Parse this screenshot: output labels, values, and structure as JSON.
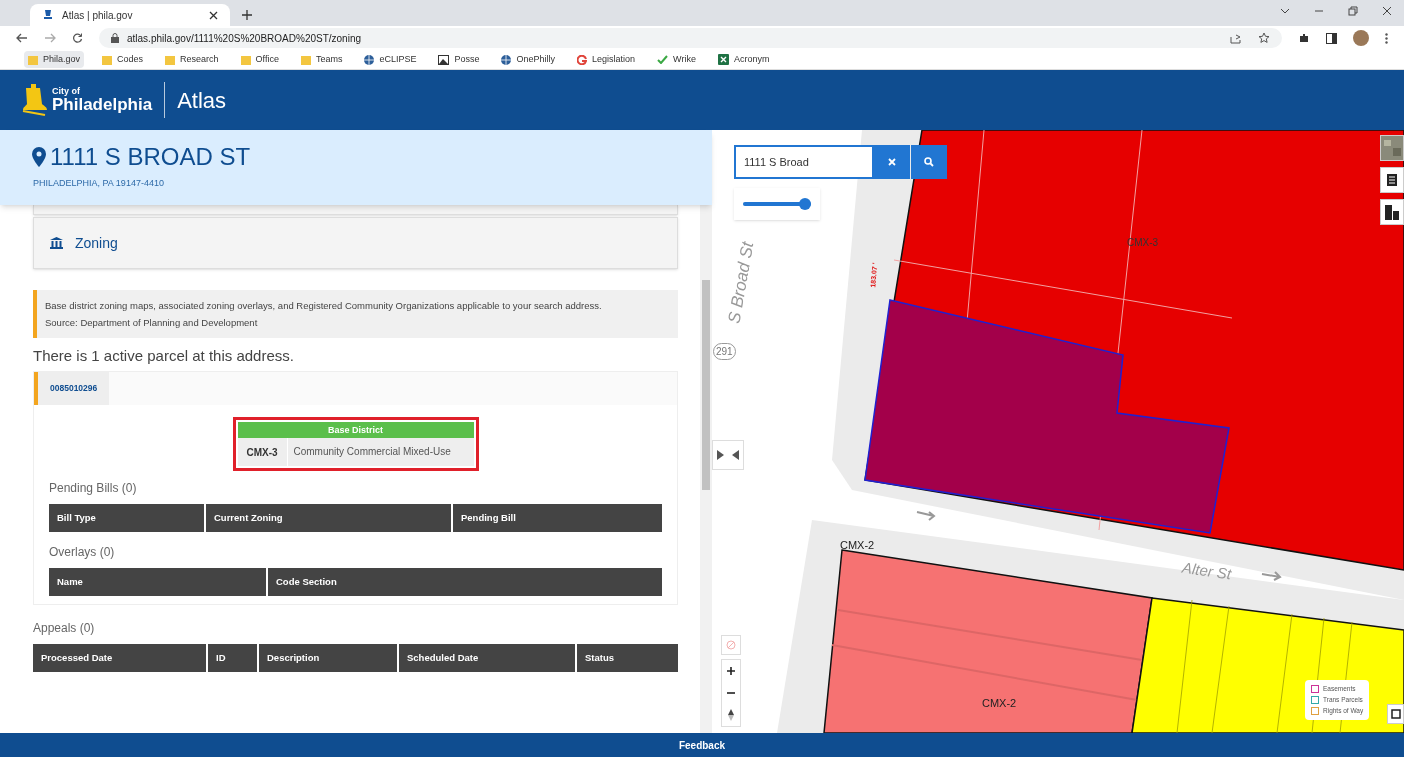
{
  "browser": {
    "tab_title": "Atlas | phila.gov",
    "url": "atlas.phila.gov/1111%20S%20BROAD%20ST/zoning",
    "bookmarks": [
      {
        "label": "Phila.gov",
        "kind": "folder"
      },
      {
        "label": "Codes",
        "kind": "folder"
      },
      {
        "label": "Research",
        "kind": "folder"
      },
      {
        "label": "Office",
        "kind": "folder"
      },
      {
        "label": "Teams",
        "kind": "folder"
      },
      {
        "label": "eCLIPSE",
        "kind": "globe"
      },
      {
        "label": "Posse",
        "kind": "image"
      },
      {
        "label": "OnePhilly",
        "kind": "globe"
      },
      {
        "label": "Legislation",
        "kind": "google"
      },
      {
        "label": "Wrike",
        "kind": "check"
      },
      {
        "label": "Acronym",
        "kind": "excel"
      }
    ]
  },
  "app": {
    "logo_top": "City of",
    "logo_bottom": "Philadelphia",
    "title": "Atlas"
  },
  "address": {
    "title": "1111 S BROAD ST",
    "subtitle": "PHILADELPHIA, PA 19147-4410"
  },
  "section": {
    "title": "Zoning",
    "description": "Base district zoning maps, associated zoning overlays, and Registered Community Organizations applicable to your search address.",
    "source": "Source: Department of Planning and Development"
  },
  "parcel_count": "There is 1 active parcel at this address.",
  "parcel_tabs": [
    {
      "label": "0085010296",
      "selected": true
    }
  ],
  "base_district": {
    "title": "Base District",
    "code": "CMX-3",
    "name": "Community Commercial Mixed-Use"
  },
  "pending_bills": {
    "title": "Pending Bills (0)",
    "columns": [
      "Bill Type",
      "Current Zoning",
      "Pending Bill"
    ]
  },
  "overlays": {
    "title": "Overlays (0)",
    "columns": [
      "Name",
      "Code Section"
    ]
  },
  "appeals": {
    "title": "Appeals (0)",
    "columns": [
      "Processed Date",
      "ID",
      "Description",
      "Scheduled Date",
      "Status"
    ]
  },
  "map": {
    "search": {
      "value": "1111 S Broad"
    },
    "opacity_slider": {
      "level": 1.0
    },
    "labels": [
      {
        "text": "CMX-3",
        "kind": "zone"
      },
      {
        "text": "CMX-2",
        "kind": "zone"
      },
      {
        "text": "CMX-2",
        "kind": "zone"
      },
      {
        "text": "S Broad St",
        "kind": "street"
      },
      {
        "text": "Alter St",
        "kind": "street"
      },
      {
        "text": "291",
        "kind": "route"
      },
      {
        "text": "183.07 '",
        "kind": "dimension"
      }
    ],
    "legend": [
      {
        "label": "Easements",
        "color": "#cc3399"
      },
      {
        "label": "Trans Parcels",
        "color": "#33aaaa"
      },
      {
        "label": "Rights of Way",
        "color": "#e0a040"
      }
    ]
  },
  "footer": {
    "feedback": "Feedback"
  }
}
